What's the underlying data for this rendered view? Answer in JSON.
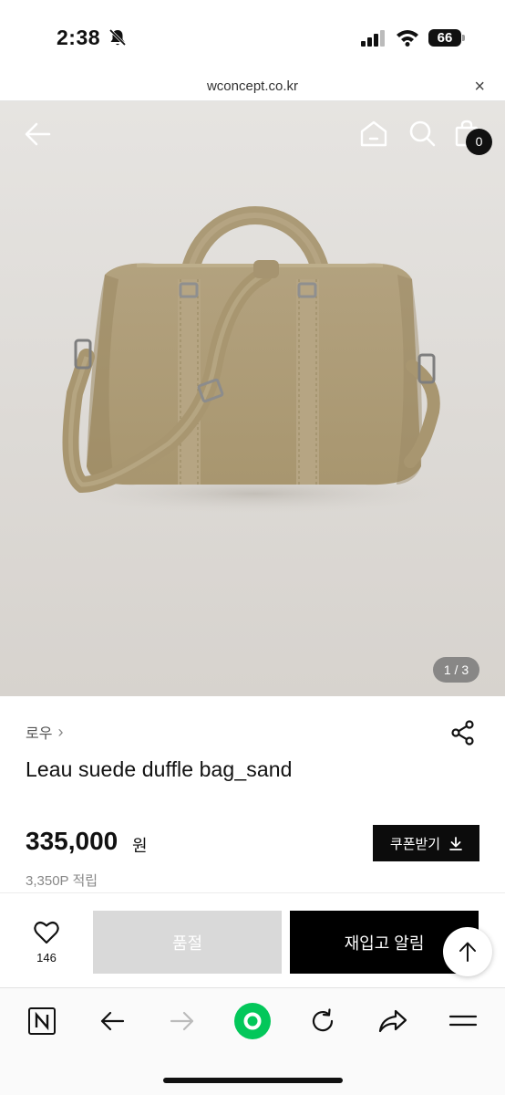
{
  "status_bar": {
    "time": "2:38",
    "battery": "66"
  },
  "browser": {
    "url": "wconcept.co.kr",
    "close_label": "×"
  },
  "header": {
    "cart_count": "0"
  },
  "gallery": {
    "pager": "1 / 3"
  },
  "product": {
    "brand": "로우",
    "brand_chevron": "›",
    "title": "Leau suede duffle bag_sand",
    "price": "335,000",
    "price_unit": "원",
    "points": "3,350P 적립",
    "coupon_label": "쿠폰받기"
  },
  "actions": {
    "like_count": "146",
    "soldout_label": "품절",
    "restock_label": "재입고 알림"
  },
  "colors": {
    "accent": "#000000",
    "soldout_bg": "#d9d9d9",
    "naver_green": "#03c75a"
  }
}
